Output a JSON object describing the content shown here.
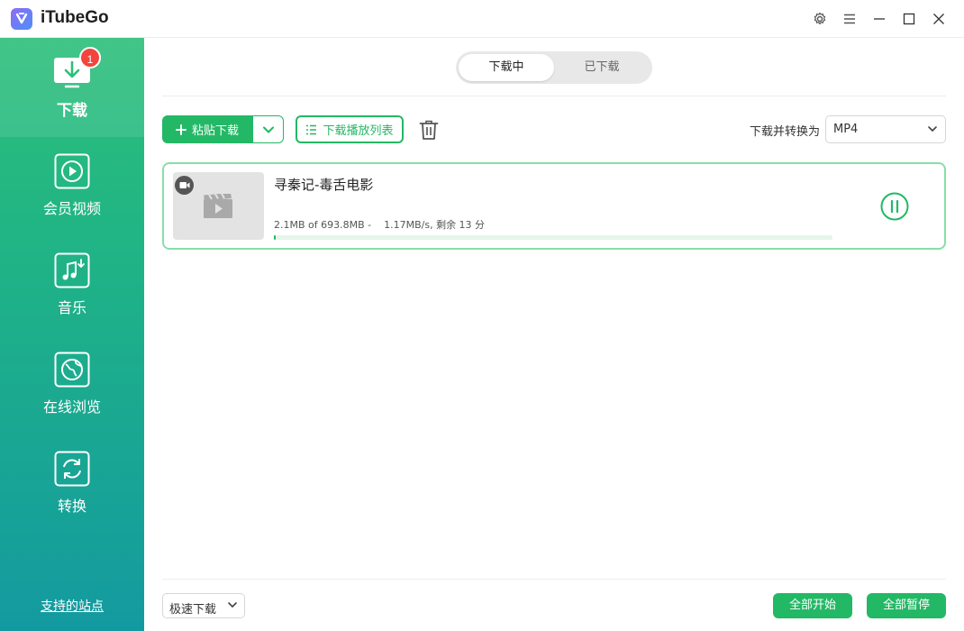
{
  "app": {
    "title": "iTubeGo"
  },
  "titlebar": {
    "icons": [
      "settings-icon",
      "menu-icon",
      "minimize-icon",
      "maximize-icon",
      "close-icon"
    ]
  },
  "sidebar": {
    "items": [
      {
        "label": "下载",
        "icon": "download-icon",
        "badge": "1",
        "active": true
      },
      {
        "label": "会员视频",
        "icon": "play-circle-icon"
      },
      {
        "label": "音乐",
        "icon": "music-icon"
      },
      {
        "label": "在线浏览",
        "icon": "globe-icon"
      },
      {
        "label": "转换",
        "icon": "convert-icon"
      }
    ],
    "support_link": "支持的站点"
  },
  "tabs": {
    "downloading": "下载中",
    "downloaded": "已下载",
    "active": "downloading"
  },
  "toolbar": {
    "paste_label": "粘贴下载",
    "playlist_label": "下载播放列表",
    "convert_label": "下载并转换为",
    "format_value": "MP4"
  },
  "downloads": [
    {
      "title": "寻秦记-毒舌电影",
      "progress_text": "2.1MB of 693.8MB -    1.17MB/s, 剩余 13 分",
      "progress_fraction": 0.003
    }
  ],
  "footer": {
    "speed_value": "极速下载",
    "start_all": "全部开始",
    "pause_all": "全部暂停"
  },
  "colors": {
    "accent": "#23b865",
    "sidebar_top": "#2cbf7a",
    "sidebar_bottom": "#139aa0",
    "badge": "#f2453d"
  }
}
